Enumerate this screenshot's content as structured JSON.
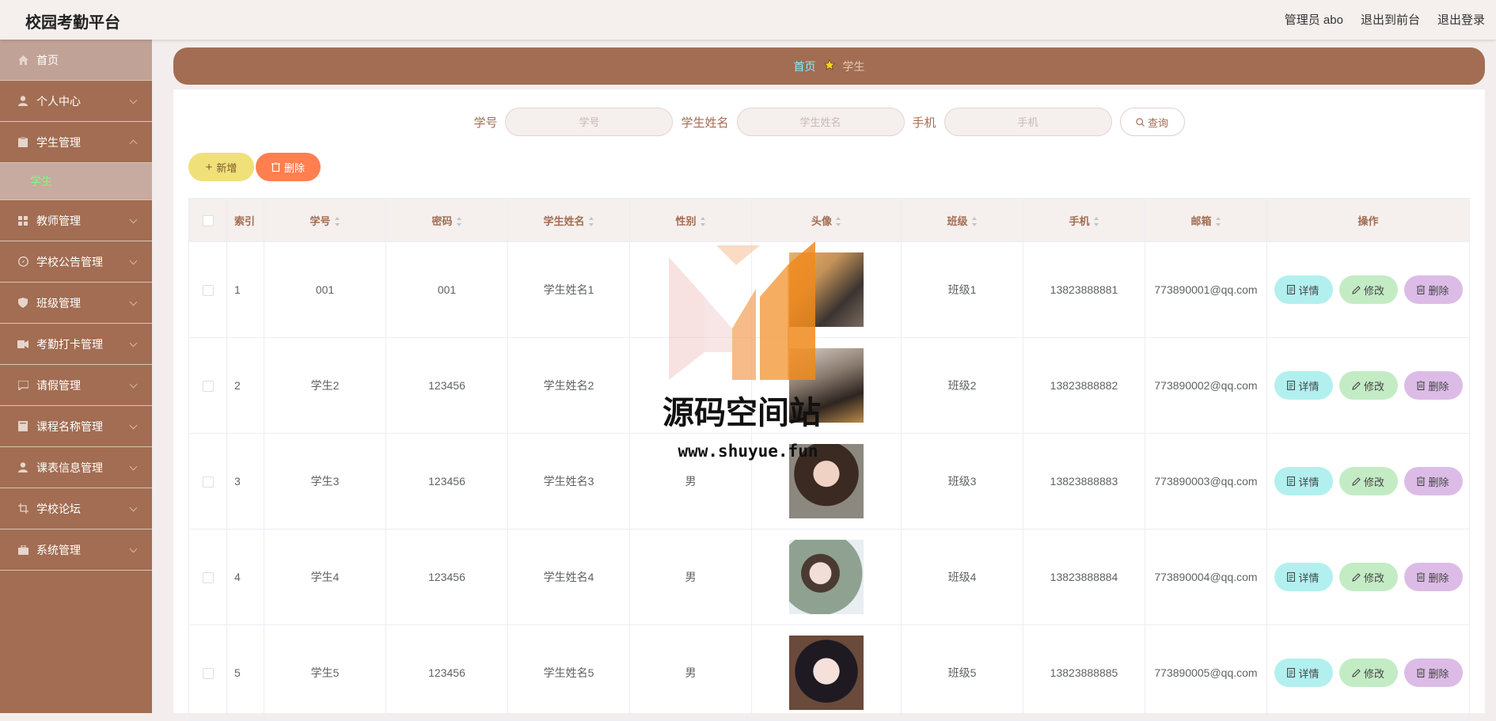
{
  "app": {
    "title": "校园考勤平台"
  },
  "topnav": {
    "user": "管理员 abo",
    "front": "退出到前台",
    "logout": "退出登录"
  },
  "sidebar": {
    "items": [
      {
        "label": "首页",
        "icon": "home-icon"
      },
      {
        "label": "个人中心",
        "icon": "user-icon"
      },
      {
        "label": "学生管理",
        "icon": "clipboard-icon",
        "sub": "学生"
      },
      {
        "label": "教师管理",
        "icon": "grid-icon"
      },
      {
        "label": "学校公告管理",
        "icon": "compass-icon"
      },
      {
        "label": "班级管理",
        "icon": "shield-icon"
      },
      {
        "label": "考勤打卡管理",
        "icon": "video-icon"
      },
      {
        "label": "请假管理",
        "icon": "chat-icon"
      },
      {
        "label": "课程名称管理",
        "icon": "book-icon"
      },
      {
        "label": "课表信息管理",
        "icon": "user-icon"
      },
      {
        "label": "学校论坛",
        "icon": "crop-icon"
      },
      {
        "label": "系统管理",
        "icon": "briefcase-icon"
      }
    ]
  },
  "breadcrumb": {
    "home": "首页",
    "current": "学生"
  },
  "search": {
    "label_id": "学号",
    "ph_id": "学号",
    "label_name": "学生姓名",
    "ph_name": "学生姓名",
    "label_phone": "手机",
    "ph_phone": "手机",
    "query": "查询"
  },
  "toolbar": {
    "add": "新增",
    "delete": "删除"
  },
  "table": {
    "headers": [
      "索引",
      "学号",
      "密码",
      "学生姓名",
      "性别",
      "头像",
      "班级",
      "手机",
      "邮箱",
      "操作"
    ],
    "rows": [
      {
        "idx": "1",
        "sid": "001",
        "pwd": "001",
        "name": "学生姓名1",
        "gender": "",
        "cls": "班级1",
        "phone": "13823888881",
        "email": "773890001@qq.com"
      },
      {
        "idx": "2",
        "sid": "学生2",
        "pwd": "123456",
        "name": "学生姓名2",
        "gender": "",
        "cls": "班级2",
        "phone": "13823888882",
        "email": "773890002@qq.com"
      },
      {
        "idx": "3",
        "sid": "学生3",
        "pwd": "123456",
        "name": "学生姓名3",
        "gender": "男",
        "cls": "班级3",
        "phone": "13823888883",
        "email": "773890003@qq.com"
      },
      {
        "idx": "4",
        "sid": "学生4",
        "pwd": "123456",
        "name": "学生姓名4",
        "gender": "男",
        "cls": "班级4",
        "phone": "13823888884",
        "email": "773890004@qq.com"
      },
      {
        "idx": "5",
        "sid": "学生5",
        "pwd": "123456",
        "name": "学生姓名5",
        "gender": "男",
        "cls": "班级5",
        "phone": "13823888885",
        "email": "773890005@qq.com"
      }
    ],
    "ops": {
      "detail": "详情",
      "edit": "修改",
      "remove": "删除"
    }
  },
  "watermark": {
    "title": "源码空间站",
    "url": "www.shuyue.fun"
  }
}
